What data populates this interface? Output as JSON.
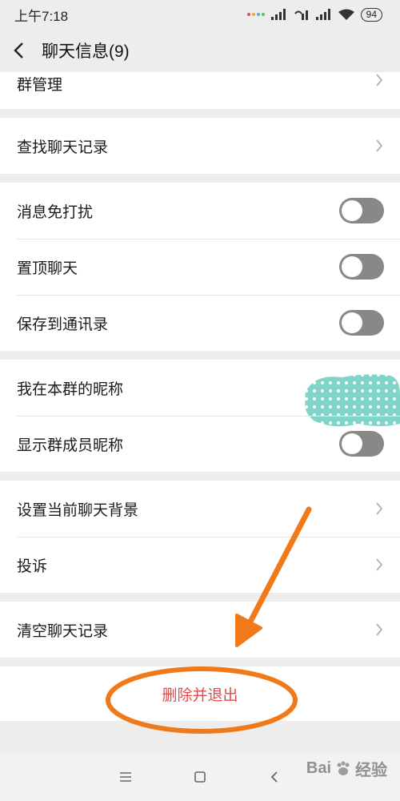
{
  "status_bar": {
    "time": "上午7:18",
    "battery": "94",
    "signal_icons": [
      "cellular-signal-icon",
      "missed-call-signal-icon",
      "cellular-signal-icon",
      "wifi-icon"
    ]
  },
  "header": {
    "title": "聊天信息(9)",
    "back_icon": "chevron-left-icon"
  },
  "sections": {
    "group_manage": {
      "label": "群管理"
    },
    "find_history": {
      "label": "查找聊天记录"
    },
    "mute": {
      "label": "消息免打扰",
      "toggle_on": false
    },
    "pin": {
      "label": "置顶聊天",
      "toggle_on": false
    },
    "save_contacts": {
      "label": "保存到通讯录",
      "toggle_on": false
    },
    "my_nickname": {
      "label": "我在本群的昵称"
    },
    "show_nicknames": {
      "label": "显示群成员昵称",
      "toggle_on": false
    },
    "set_background": {
      "label": "设置当前聊天背景"
    },
    "report": {
      "label": "投诉"
    },
    "clear_history": {
      "label": "清空聊天记录"
    },
    "delete_exit": {
      "label": "删除并退出"
    }
  },
  "nav_bar": {
    "menu_icon": "menu-icon",
    "home_icon": "square-home-icon",
    "back_icon": "back-triangle-icon"
  },
  "watermark": {
    "text": "Bai",
    "suffix": "经验"
  },
  "colors": {
    "annotation": "#f07a1a",
    "danger": "#e04a4a",
    "toggle_off": "#888888",
    "blob": "#7fd6c8"
  }
}
